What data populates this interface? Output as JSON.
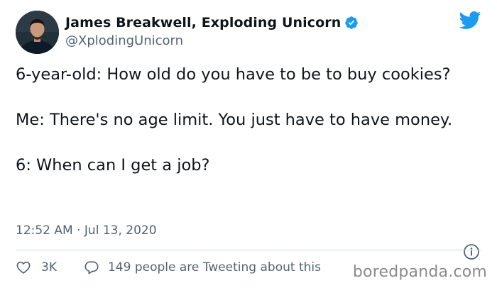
{
  "author": {
    "display_name": "James Breakwell, Exploding Unicorn",
    "handle": "@XplodingUnicorn"
  },
  "tweet": {
    "lines": [
      "6-year-old: How old do you have to be to buy cookies?",
      "Me: There's no age limit. You just have to have money.",
      "6: When can I get a job?"
    ],
    "timestamp": "12:52 AM · Jul 13, 2020"
  },
  "actions": {
    "like_count": "3K",
    "tweeting_about": "149 people are Tweeting about this"
  },
  "watermark": "boredpanda.com",
  "icons": {
    "verified": "verified-badge-icon",
    "brand": "twitter-bird-icon",
    "info": "info-icon",
    "like": "heart-icon",
    "reply": "reply-bubble-icon"
  },
  "colors": {
    "brand_blue": "#1d9bf0",
    "text_primary": "#0f1419",
    "text_secondary": "#536471",
    "divider": "#cfd9de",
    "watermark": "#8a8a8a"
  }
}
